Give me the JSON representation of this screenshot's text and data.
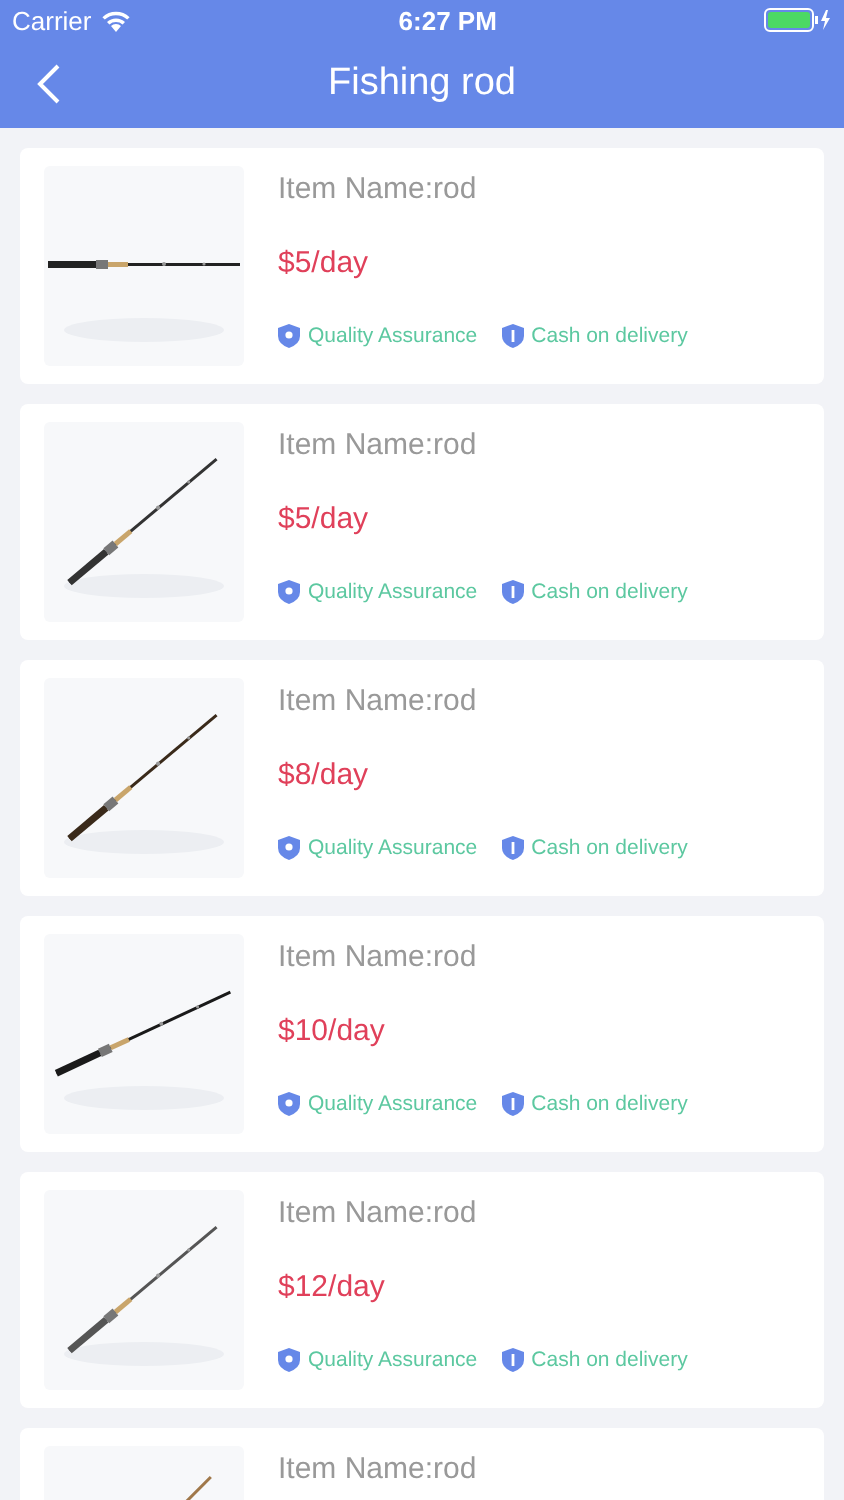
{
  "status_bar": {
    "carrier": "Carrier",
    "time": "6:27 PM"
  },
  "nav_bar": {
    "title": "Fishing rod"
  },
  "items": [
    {
      "name": "Item Name:rod",
      "price": "$5/day",
      "tags": [
        "Quality Assurance",
        "Cash on delivery"
      ]
    },
    {
      "name": "Item Name:rod",
      "price": "$5/day",
      "tags": [
        "Quality Assurance",
        "Cash on delivery"
      ]
    },
    {
      "name": "Item Name:rod",
      "price": "$8/day",
      "tags": [
        "Quality Assurance",
        "Cash on delivery"
      ]
    },
    {
      "name": "Item Name:rod",
      "price": "$10/day",
      "tags": [
        "Quality Assurance",
        "Cash on delivery"
      ]
    },
    {
      "name": "Item Name:rod",
      "price": "$12/day",
      "tags": [
        "Quality Assurance",
        "Cash on delivery"
      ]
    },
    {
      "name": "Item Name:rod"
    }
  ]
}
